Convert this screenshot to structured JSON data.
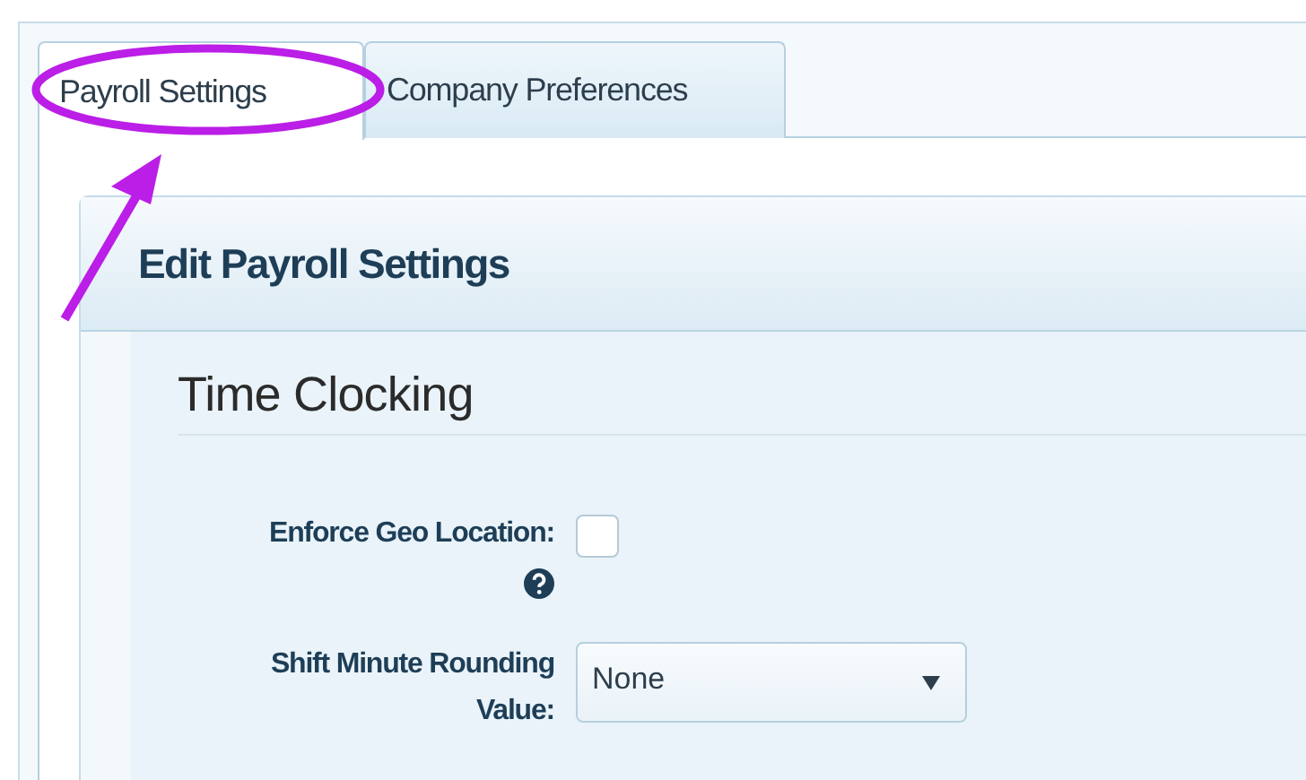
{
  "tabs": [
    {
      "label": "Payroll Settings",
      "selected": true
    },
    {
      "label": "Company Preferences",
      "selected": false
    }
  ],
  "panel": {
    "title": "Edit Payroll Settings"
  },
  "section": {
    "title": "Time Clocking"
  },
  "fields": [
    {
      "kind": "checkbox",
      "label": "Enforce Geo Location:",
      "checked": false,
      "help": true
    },
    {
      "kind": "select",
      "label": "Shift Minute Rounding Value:",
      "value": "None"
    }
  ],
  "annotation": {
    "kind": "circle-arrow"
  }
}
